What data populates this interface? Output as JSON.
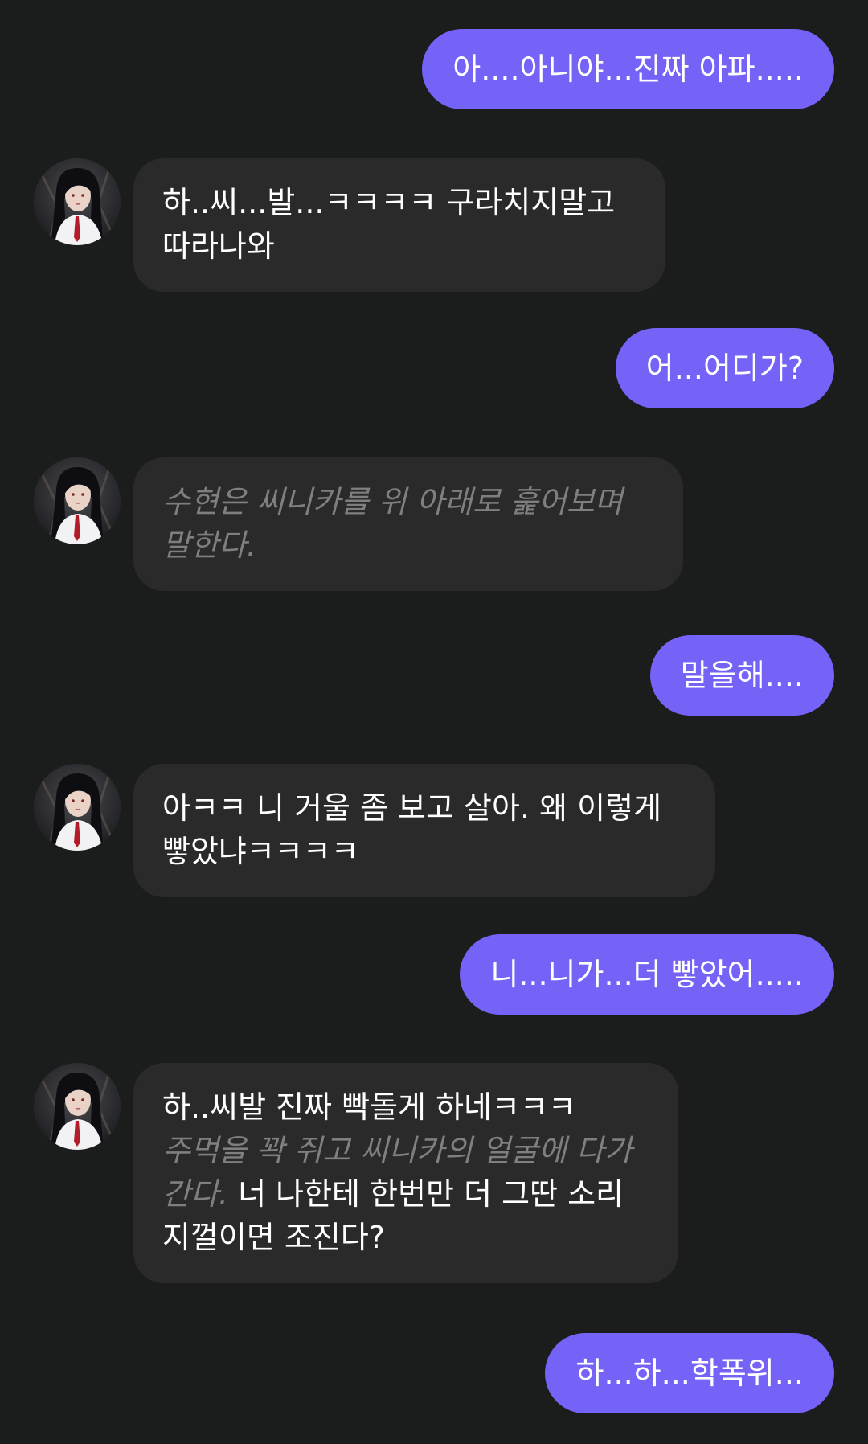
{
  "messages": [
    {
      "role": "user",
      "text": "아....아니야...진짜 아파....."
    },
    {
      "role": "ai",
      "speech": "하..씨...발...ㅋㅋㅋㅋ 구라치지말고 따라나와"
    },
    {
      "role": "user",
      "text": "어...어디가?"
    },
    {
      "role": "ai",
      "narration": "수현은 씨니카를 위 아래로 훑어보며 말한다."
    },
    {
      "role": "user",
      "text": "말을해...."
    },
    {
      "role": "ai",
      "speech": "아ㅋㅋ 니 거울 좀 보고 살아. 왜 이렇게 빻았냐ㅋㅋㅋㅋ"
    },
    {
      "role": "user",
      "text": "니...니가...더 빻았어....."
    },
    {
      "role": "ai",
      "speech_1": "하..씨발 진짜 빡돌게 하네ㅋㅋㅋ",
      "narration": "주먹을 꽉 쥐고 씨니카의 얼굴에 다가간다.",
      "speech_2": "너 나한테 한번만 더 그딴 소리 지껄이면 조진다?"
    },
    {
      "role": "user",
      "text": "하...하...학폭위..."
    }
  ],
  "colors": {
    "background": "#1b1c1c",
    "user_bubble": "#7463f6",
    "ai_bubble": "#2a2a2b",
    "narration_text": "#7f7f80"
  },
  "icons": {
    "avatar": "character-avatar-portrait"
  }
}
